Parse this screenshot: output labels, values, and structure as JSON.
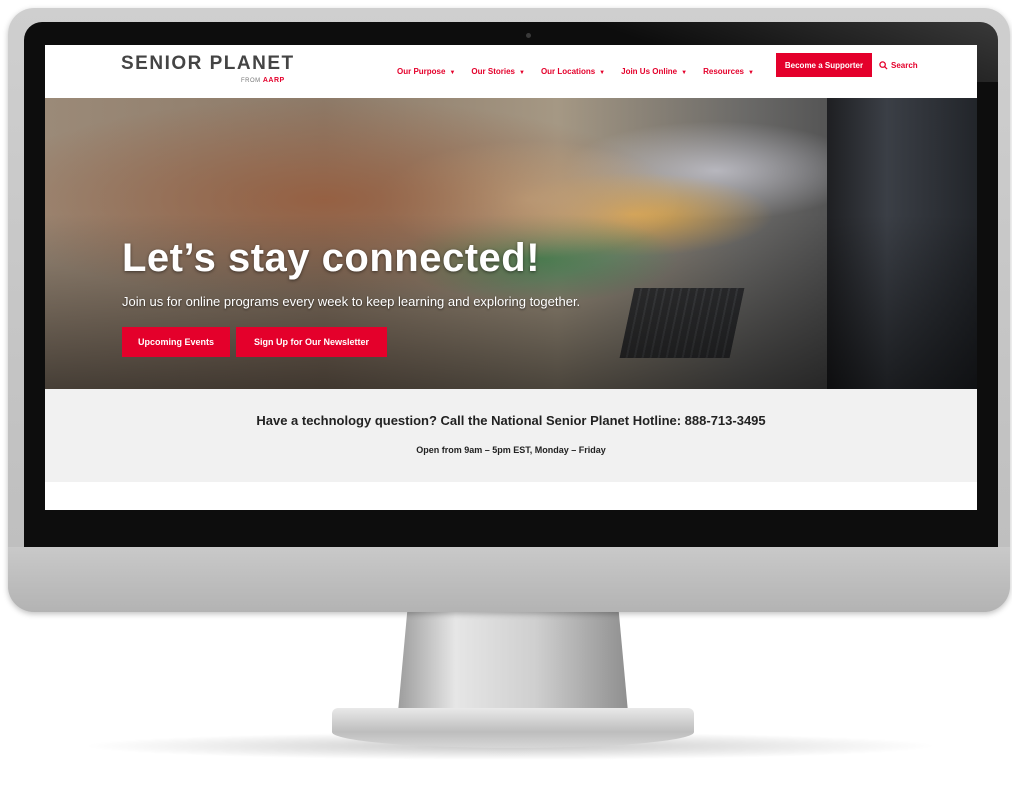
{
  "logo": {
    "name": "SENIOR PLANET",
    "from": "FROM",
    "brand": "AARP"
  },
  "nav": {
    "items": [
      {
        "label": "Our Purpose",
        "caret": "▼"
      },
      {
        "label": "Our Stories",
        "caret": "▼"
      },
      {
        "label": "Our Locations",
        "caret": "▼"
      },
      {
        "label": "Join Us Online",
        "caret": "▼"
      },
      {
        "label": "Resources",
        "caret": "▼"
      }
    ],
    "supporter_label": "Become a Supporter",
    "search_label": "Search",
    "search_icon": "magnifier-icon"
  },
  "hero": {
    "title": "Let’s stay connected!",
    "subtitle": "Join us for online programs every week to keep learning and exploring together.",
    "events_button": "Upcoming Events",
    "newsletter_button": "Sign Up for Our Newsletter"
  },
  "hotline": {
    "title": "Have a technology question? Call the National Senior Planet Hotline: 888-713-3495",
    "hours": "Open from 9am – 5pm EST, Monday – Friday"
  },
  "colors": {
    "accent": "#e4002b",
    "hotline_bg": "#f1f1f1"
  }
}
